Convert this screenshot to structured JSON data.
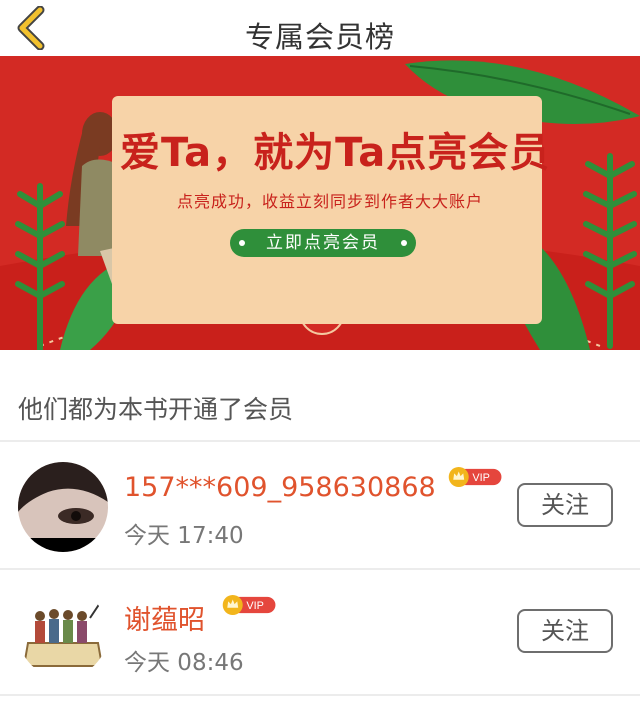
{
  "header": {
    "title": "专属会员榜"
  },
  "banner": {
    "headline": "爱Ta，就为Ta点亮会员",
    "subtitle": "点亮成功，收益立刻同步到作者大大账户",
    "button_label": "立即点亮会员"
  },
  "members_section": {
    "heading": "他们都为本书开通了会员"
  },
  "members": [
    {
      "name": "157***609_958630868",
      "badge": "VIP",
      "time": "今天 17:40",
      "follow_label": "关注"
    },
    {
      "name": "谢蕴昭",
      "badge": "VIP",
      "time": "今天 08:46",
      "follow_label": "关注"
    }
  ],
  "colors": {
    "accent": "#e0532d",
    "banner_red": "#d32a24",
    "back_arrow": "#f2c12e",
    "vip_badge": "#e5463d",
    "crown": "#f2b51c"
  }
}
